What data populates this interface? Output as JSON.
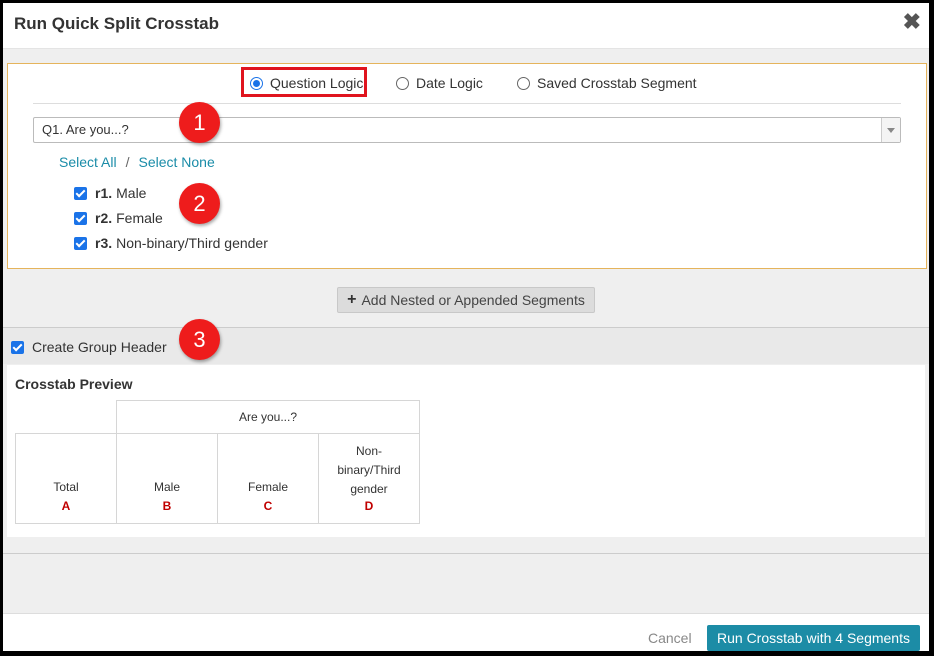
{
  "dialog": {
    "title": "Run Quick Split Crosstab",
    "close_icon": "close-icon"
  },
  "logic": {
    "options": [
      {
        "label": "Question Logic",
        "selected": true
      },
      {
        "label": "Date Logic",
        "selected": false
      },
      {
        "label": "Saved Crosstab Segment",
        "selected": false
      }
    ],
    "question_select": "Q1. Are you...?",
    "select_all": "Select All",
    "separator": "/",
    "select_none": "Select None",
    "answers": [
      {
        "code": "r1.",
        "label": "Male",
        "checked": true
      },
      {
        "code": "r2.",
        "label": "Female",
        "checked": true
      },
      {
        "code": "r3.",
        "label": "Non-binary/Third gender",
        "checked": true
      }
    ]
  },
  "badges": [
    "1",
    "2",
    "3"
  ],
  "add_segments_button": "Add Nested or Appended Segments",
  "group_header": {
    "label": "Create Group Header",
    "checked": true
  },
  "preview": {
    "title": "Crosstab Preview",
    "group_header": "Are you...?",
    "columns": [
      {
        "label": "Total",
        "letter": "A"
      },
      {
        "label": "Male",
        "letter": "B"
      },
      {
        "label": "Female",
        "letter": "C"
      },
      {
        "label": "Non-binary/Third gender",
        "letter": "D"
      }
    ]
  },
  "footer": {
    "cancel": "Cancel",
    "run": "Run Crosstab with 4 Segments"
  },
  "colors": {
    "accent": "#1c8ca6",
    "highlight": "#e0141e",
    "badge": "#ee1c1c",
    "letter": "#c00000"
  }
}
